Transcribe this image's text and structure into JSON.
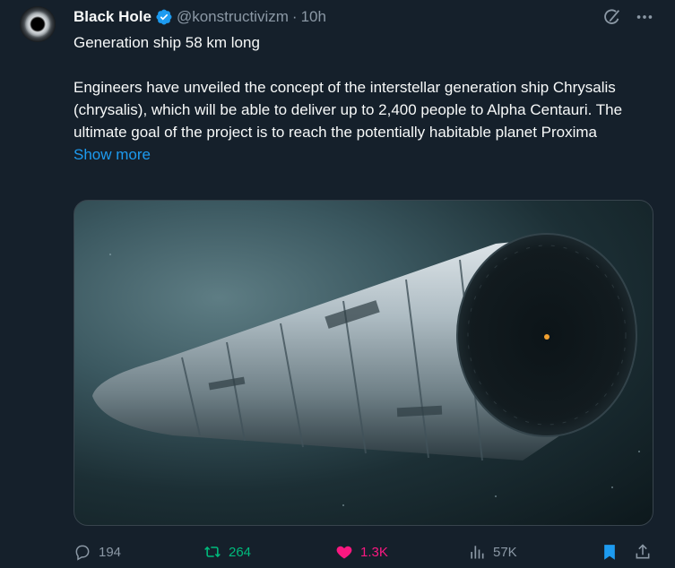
{
  "author": {
    "name": "Black Hole",
    "handle": "@konstructivizm",
    "separator": "·",
    "time": "10h",
    "verified": true,
    "verified_color": "#1d9bf0"
  },
  "tweet": {
    "title": "Generation ship 58 km long",
    "body": "Engineers have unveiled the concept of the interstellar generation ship Chrysalis (chrysalis), which will be able to deliver up to 2,400 people to Alpha Centauri. The ultimate goal of the project is to reach the potentially habitable planet Proxima",
    "show_more": "Show more"
  },
  "media": {
    "description_icon": "spaceship-image"
  },
  "actions": {
    "replies": "194",
    "reposts": "264",
    "likes": "1.3K",
    "views": "57K",
    "repost_color": "#00ba7c",
    "like_color": "#f91880",
    "bookmark_color": "#1d9bf0"
  },
  "icons": {
    "grok": "grok-icon",
    "more": "more-icon",
    "reply": "reply-icon",
    "repost": "repost-icon",
    "like": "heart-icon",
    "views": "views-icon",
    "bookmark": "bookmark-icon",
    "share": "share-icon"
  }
}
